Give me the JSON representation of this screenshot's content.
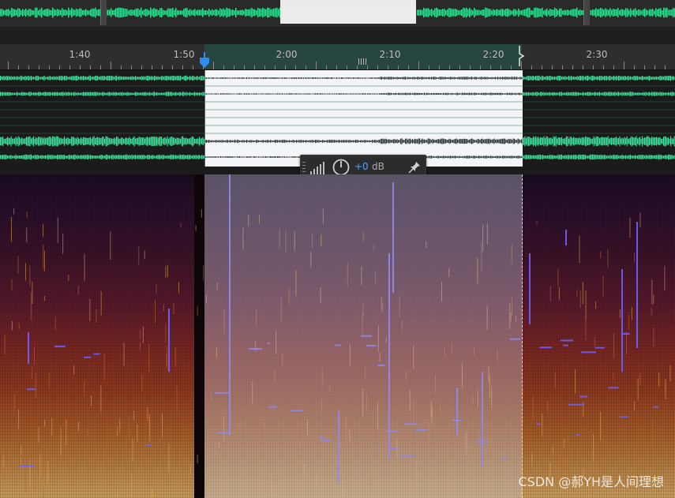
{
  "timeline": {
    "ticks": [
      "1:40",
      "1:50",
      "2:00",
      "2:10",
      "2:20",
      "2:30"
    ]
  },
  "hud": {
    "gain_value": "+0",
    "gain_unit": "dB",
    "icons": [
      "level-meter-icon",
      "power-knob-icon",
      "pin-icon"
    ]
  },
  "colors": {
    "waveform": "#3ddc97",
    "selection_wave_bg": "#f4f5f8",
    "ruler_selection": "#26463f",
    "playhead": "#2d8cf0",
    "gain_value": "#4aa3ff"
  },
  "watermark": "CSDN @郝YH是人间理想"
}
